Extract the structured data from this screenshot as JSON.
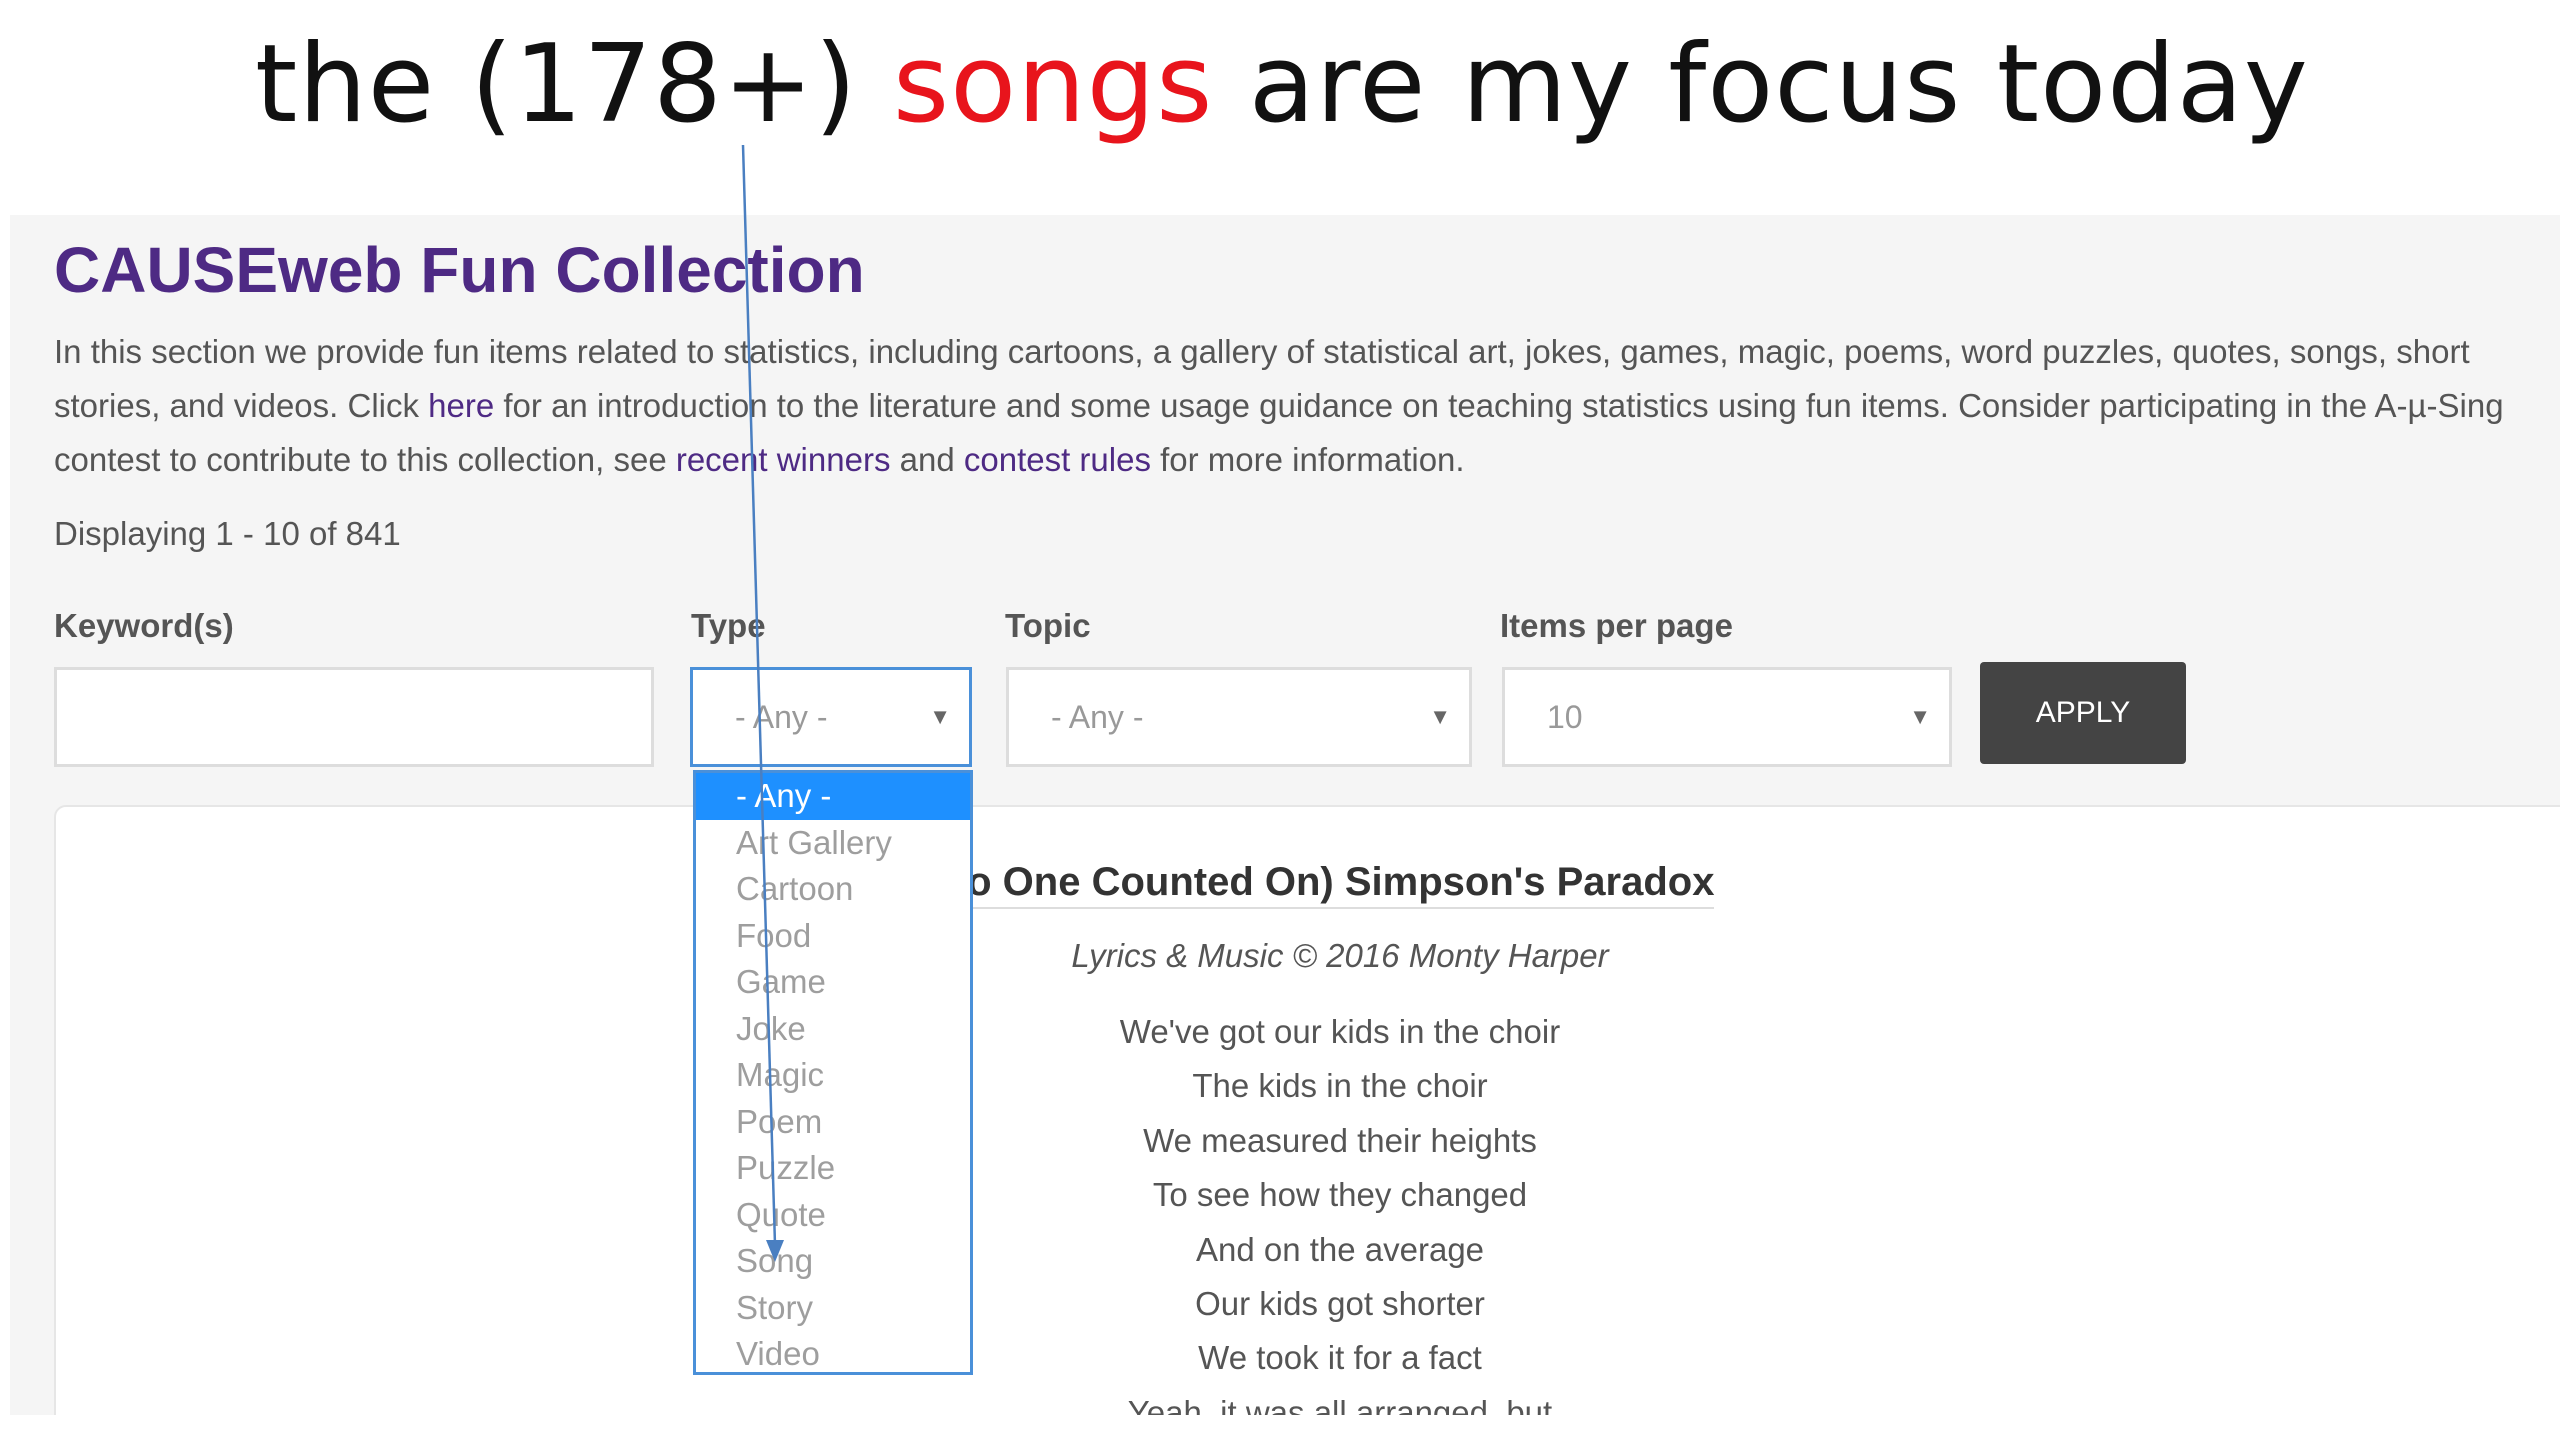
{
  "slide": {
    "title_prefix": "the (178+) ",
    "title_accent": "songs",
    "title_suffix": " are my focus today"
  },
  "page": {
    "title": "CAUSEweb Fun Collection",
    "intro": {
      "part1": "In this section we provide fun items related to statistics, including cartoons, a gallery of statistical art, jokes, games, magic, poems, word puzzles, quotes, songs, short stories, and videos. Click ",
      "link_here": "here",
      "part2": " for an introduction to the literature and some usage guidance on teaching statistics using fun items. Consider participating in the A-µ-Sing contest to contribute to this collection, see ",
      "link_winners": "recent winners",
      "part3": " and ",
      "link_rules": "contest rules",
      "part4": " for more information."
    },
    "displaying": "Displaying 1 - 10 of 841"
  },
  "filters": {
    "keyword_label": "Keyword(s)",
    "keyword_value": "",
    "type_label": "Type",
    "type_value": "- Any -",
    "topic_label": "Topic",
    "topic_value": "- Any -",
    "items_label": "Items per page",
    "items_value": "10",
    "apply_label": "APPLY"
  },
  "type_options": [
    "- Any -",
    "Art Gallery",
    "Cartoon",
    "Food",
    "Game",
    "Joke",
    "Magic",
    "Poem",
    "Puzzle",
    "Quote",
    "Song",
    "Story",
    "Video"
  ],
  "song": {
    "title": "lo One Counted On) Simpson's Paradox",
    "credit": "Lyrics & Music © 2016 Monty Harper",
    "lyrics": [
      "We've got our kids in the choir",
      "The kids in the choir",
      "We measured their heights",
      "To see how they changed",
      "And on the average",
      "Our kids got shorter",
      "We took it for a fact",
      "Yeah, it was all arranged, but"
    ]
  },
  "colors": {
    "accent_red": "#e8141c",
    "brand_purple": "#4e2a84",
    "select_highlight": "#1e90ff",
    "focus_border": "#4a90d9",
    "button_dark": "#444444"
  }
}
